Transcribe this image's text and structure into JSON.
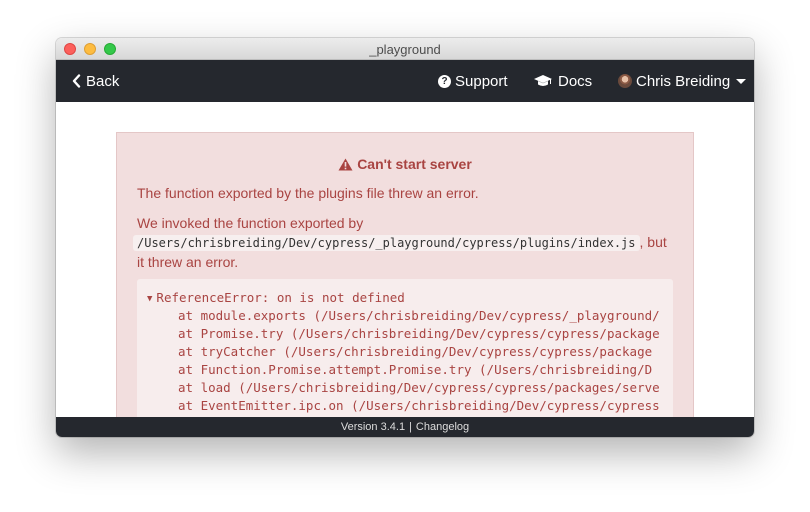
{
  "window": {
    "title": "_playground"
  },
  "nav": {
    "back_label": "Back",
    "support_label": "Support",
    "docs_label": "Docs",
    "user_name": "Chris Breiding",
    "icons": {
      "back": "chevron-left-icon",
      "support": "question-circle-icon",
      "docs": "graduation-cap-icon",
      "user": "avatar",
      "menu": "caret-down-icon"
    }
  },
  "alert": {
    "title": "Can't start server",
    "message1": "The function exported by the plugins file threw an error.",
    "message2_before": "We invoked the function exported by",
    "plugins_path": "/Users/chrisbreiding/Dev/cypress/_playground/cypress/plugins/index.js",
    "message2_after": ", but it threw an error.",
    "icon": "warning-triangle-icon",
    "color": "#a94442",
    "background": "#f2dede"
  },
  "stack": {
    "toggle_icon": "▼",
    "error": "ReferenceError: on is not defined",
    "lines": [
      "at module.exports (/Users/chrisbreiding/Dev/cypress/_playground/",
      "at Promise.try (/Users/chrisbreiding/Dev/cypress/cypress/package",
      "at tryCatcher (/Users/chrisbreiding/Dev/cypress/cypress/package",
      "at Function.Promise.attempt.Promise.try (/Users/chrisbreiding/D",
      "at load (/Users/chrisbreiding/Dev/cypress/cypress/packages/serve",
      "at EventEmitter.ipc.on (/Users/chrisbreiding/Dev/cypress/cypress"
    ]
  },
  "footer": {
    "version": "Version 3.4.1",
    "separator": "|",
    "changelog": "Changelog"
  }
}
